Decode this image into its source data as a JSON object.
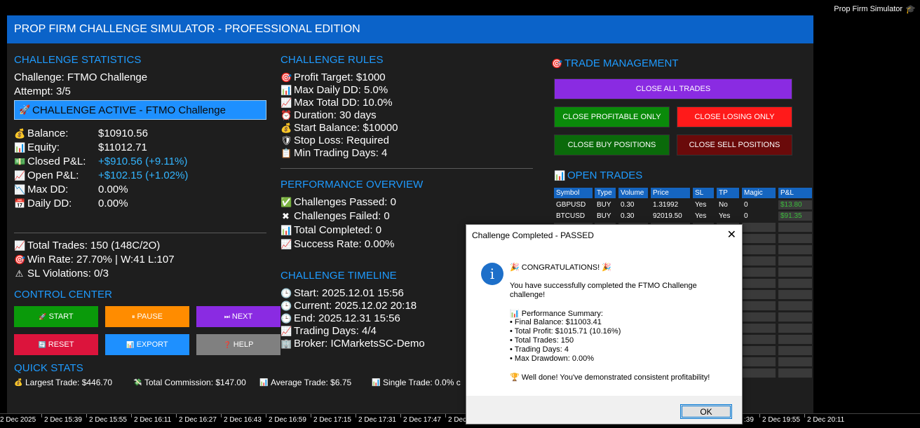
{
  "window_title": "Prop Firm Simulator",
  "header": "PROP FIRM CHALLENGE SIMULATOR - PROFESSIONAL EDITION",
  "stats": {
    "title": "CHALLENGE STATISTICS",
    "challenge": "Challenge: FTMO Challenge",
    "attempt": "Attempt: 3/5",
    "active_banner": "CHALLENGE ACTIVE - FTMO Challenge",
    "balance_label": "Balance:",
    "balance_value": "$10910.56",
    "equity_label": "Equity:",
    "equity_value": "$11012.71",
    "closed_label": "Closed P&L:",
    "closed_value": "+$910.56 (+9.11%)",
    "open_label": "Open P&L:",
    "open_value": "+$102.15 (+1.02%)",
    "maxdd_label": "Max DD:",
    "maxdd_value": "0.00%",
    "dailydd_label": "Daily DD:",
    "dailydd_value": "0.00%",
    "total_trades": "Total Trades: 150 (148C/2O)",
    "win_rate": "Win Rate: 27.70% | W:41 L:107",
    "sl_violations": "SL Violations: 0/3"
  },
  "rules": {
    "title": "CHALLENGE RULES",
    "items": [
      "Profit Target: $1000",
      "Max Daily DD: 5.0%",
      "Max Total DD: 10.0%",
      "Duration: 30 days",
      "Start Balance: $10000",
      "Stop Loss: Required",
      "Min Trading Days: 4"
    ]
  },
  "performance": {
    "title": "PERFORMANCE OVERVIEW",
    "items": [
      "Challenges Passed: 0",
      "Challenges Failed: 0",
      "Total Completed: 0",
      "Success Rate: 0.00%"
    ]
  },
  "timeline": {
    "title": "CHALLENGE TIMELINE",
    "items": [
      "Start: 2025.12.01 15:56",
      "Current: 2025.12.02 20:18",
      "End: 2025.12.31 15:56",
      "Trading Days: 4/4",
      "Broker: ICMarketsSC-Demo"
    ]
  },
  "control": {
    "title": "CONTROL CENTER",
    "start": "START",
    "pause": "PAUSE",
    "next": "NEXT",
    "reset": "RESET",
    "export": "EXPORT",
    "help": "HELP"
  },
  "trade_mgmt": {
    "title": "TRADE MANAGEMENT",
    "close_all": "CLOSE ALL TRADES",
    "close_profitable": "CLOSE PROFITABLE ONLY",
    "close_losing": "CLOSE LOSING ONLY",
    "close_buy": "CLOSE BUY POSITIONS",
    "close_sell": "CLOSE SELL POSITIONS"
  },
  "open_trades": {
    "title": "OPEN TRADES",
    "columns": [
      "Symbol",
      "Type",
      "Volume",
      "Price",
      "SL",
      "TP",
      "Magic",
      "P&L"
    ],
    "rows": [
      [
        "GBPUSD",
        "BUY",
        "0.30",
        "1.31992",
        "Yes",
        "No",
        "0",
        "$13.80"
      ],
      [
        "BTCUSD",
        "BUY",
        "0.30",
        "92019.50",
        "Yes",
        "Yes",
        "0",
        "$91.35"
      ]
    ]
  },
  "quick_stats": {
    "title": "QUICK STATS",
    "largest": "Largest Trade: $446.70",
    "commission": "Total Commission: $147.00",
    "average": "Average Trade: $6.75",
    "single": "Single Trade: 0.0% c"
  },
  "time_axis": [
    "2 Dec 2025",
    "2 Dec 15:39",
    "2 Dec 15:55",
    "2 Dec 16:11",
    "2 Dec 16:27",
    "2 Dec 16:43",
    "2 Dec 16:59",
    "2 Dec 17:15",
    "2 Dec 17:31",
    "2 Dec 17:47",
    "2 Dec",
    ":39",
    "2 Dec 19:55",
    "2 Dec 20:11"
  ],
  "dialog": {
    "title": "Challenge Completed - PASSED",
    "congrats": "🎉 CONGRATULATIONS! 🎉",
    "msg1": "You have successfully completed the FTMO Challenge",
    "msg2": "challenge!",
    "summary_title": "📊 Performance Summary:",
    "final_balance": "• Final Balance: $11003.41",
    "total_profit": "• Total Profit: $1015.71 (10.16%)",
    "total_trades": "• Total Trades: 150",
    "trading_days": "• Trading Days: 4",
    "max_drawdown": "• Max Drawdown: 0.00%",
    "well_done": "🏆 Well done! You've demonstrated consistent profitability!",
    "ok": "OK"
  },
  "colors": {
    "header_bg": "#0b63c9",
    "section_title": "#1e9bff",
    "close_all": "#8a2be2",
    "close_profitable": "#0a8a0a",
    "close_losing": "#ff1a1a",
    "close_buy": "#0a6a0a",
    "close_sell": "#6a0a0a",
    "start": "#0a9a0a",
    "pause": "#ff8c00",
    "next": "#8a2be2",
    "reset": "#dc143c",
    "export": "#1e90ff",
    "help": "#808080"
  }
}
